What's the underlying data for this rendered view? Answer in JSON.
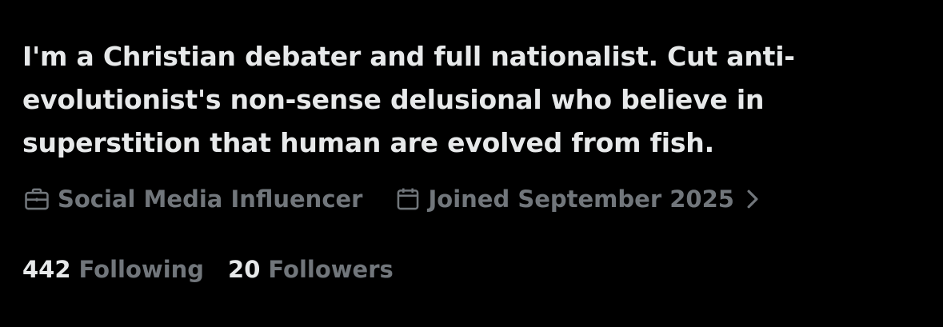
{
  "profile": {
    "bio_lines": [
      "I'm a Christian debater and full nationalist. Cut anti-",
      "evolutionist's non-sense delusional who believe in",
      "superstition that human are evolved from fish."
    ],
    "category": "Social Media Influencer",
    "category_icon": "briefcase-icon",
    "joined": "Joined September 2025",
    "joined_icon": "calendar-icon",
    "following_count": "442",
    "following_label": "Following",
    "followers_count": "20",
    "followers_label": "Followers"
  },
  "colors": {
    "background": "#000000",
    "primary_text": "#e7e9ea",
    "secondary_text": "#71767b"
  }
}
